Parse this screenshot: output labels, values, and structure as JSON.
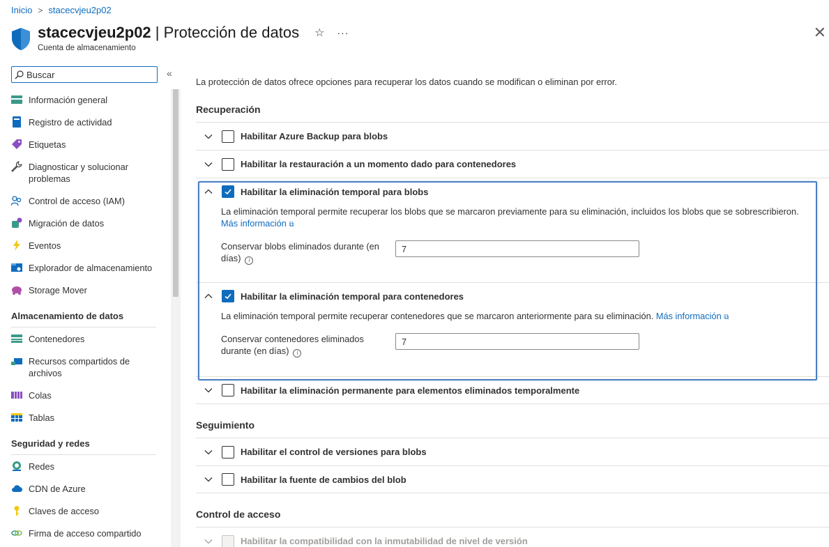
{
  "breadcrumb": {
    "home": "Inicio",
    "resource": "stacecvjeu2p02"
  },
  "header": {
    "resource_name": "stacecvjeu2p02",
    "separator": " | ",
    "page_title": "Protección de datos",
    "subtitle": "Cuenta de almacenamiento",
    "star": "☆",
    "more": "···",
    "close": "✕"
  },
  "sidebar": {
    "search_placeholder": "Buscar",
    "collapse": "«",
    "items": [
      {
        "label": "Información general",
        "icon": "overview-icon"
      },
      {
        "label": "Registro de actividad",
        "icon": "activity-log-icon"
      },
      {
        "label": "Etiquetas",
        "icon": "tag-icon"
      },
      {
        "label": "Diagnosticar y solucionar problemas",
        "icon": "wrench-icon"
      },
      {
        "label": "Control de acceso (IAM)",
        "icon": "people-icon"
      },
      {
        "label": "Migración de datos",
        "icon": "migration-icon"
      },
      {
        "label": "Eventos",
        "icon": "lightning-icon"
      },
      {
        "label": "Explorador de almacenamiento",
        "icon": "storage-explorer-icon"
      },
      {
        "label": "Storage Mover",
        "icon": "storage-mover-icon"
      }
    ],
    "section_storage": "Almacenamiento de datos",
    "storage_items": [
      {
        "label": "Contenedores",
        "icon": "containers-icon"
      },
      {
        "label": "Recursos compartidos de archivos",
        "icon": "file-shares-icon"
      },
      {
        "label": "Colas",
        "icon": "queues-icon"
      },
      {
        "label": "Tablas",
        "icon": "tables-icon"
      }
    ],
    "section_security": "Seguridad y redes",
    "security_items": [
      {
        "label": "Redes",
        "icon": "network-icon"
      },
      {
        "label": "CDN de Azure",
        "icon": "cloud-icon"
      },
      {
        "label": "Claves de acceso",
        "icon": "key-icon"
      },
      {
        "label": "Firma de acceso compartido",
        "icon": "link-icon"
      }
    ]
  },
  "main": {
    "intro": "La protección de datos ofrece opciones para recuperar los datos cuando se modifican o eliminan por error.",
    "recovery_heading": "Recuperación",
    "backup_label": "Habilitar Azure Backup para blobs",
    "restore_label": "Habilitar la restauración a un momento dado para contenedores",
    "soft_blob": {
      "label": "Habilitar la eliminación temporal para blobs",
      "desc": "La eliminación temporal permite recuperar los blobs que se marcaron previamente para su eliminación, incluidos los blobs que se sobrescribieron.",
      "link": "Más información",
      "field_label": "Conservar blobs eliminados durante (en días)",
      "field_value": "7"
    },
    "soft_container": {
      "label": "Habilitar la eliminación temporal para contenedores",
      "desc": "La eliminación temporal permite recuperar contenedores que se marcaron anteriormente para su eliminación.",
      "link": "Más información",
      "field_label": "Conservar contenedores eliminados durante (en días)",
      "field_value": "7"
    },
    "permanent_label": "Habilitar la eliminación permanente para elementos eliminados temporalmente",
    "tracking_heading": "Seguimiento",
    "versioning_label": "Habilitar el control de versiones para blobs",
    "changefeed_label": "Habilitar la fuente de cambios del blob",
    "access_heading": "Control de acceso",
    "immutability_label": "Habilitar la compatibilidad con la inmutabilidad de nivel de versión"
  },
  "colors": {
    "accent": "#0f6cbd",
    "highlight_border": "#4a7fc1"
  }
}
